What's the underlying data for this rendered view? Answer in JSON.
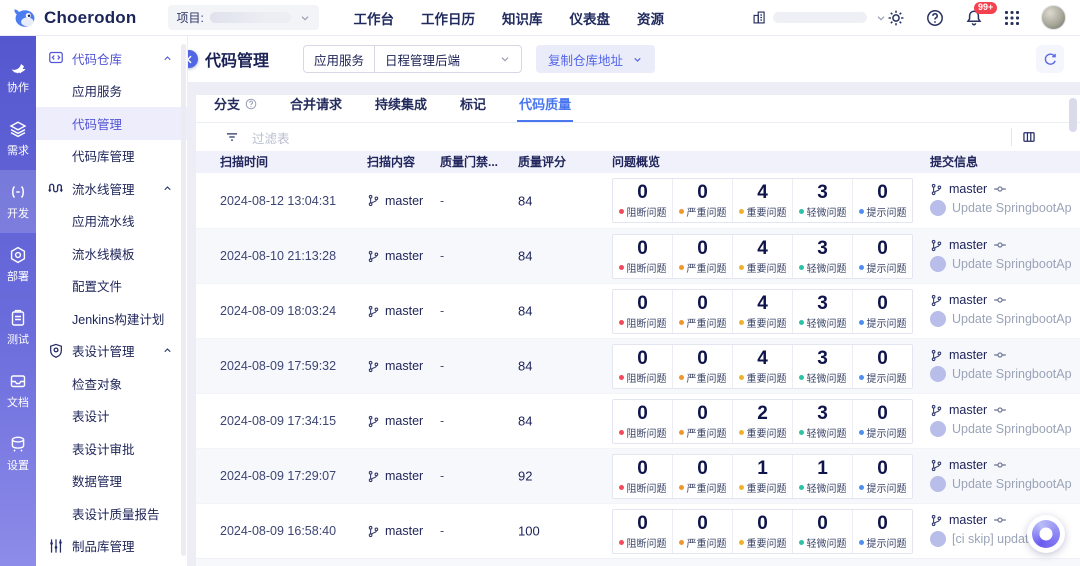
{
  "topbar": {
    "logo_text": "Choerodon",
    "project_label": "项目:",
    "nav": [
      {
        "label": "工作台"
      },
      {
        "label": "工作日历"
      },
      {
        "label": "知识库"
      },
      {
        "label": "仪表盘"
      },
      {
        "label": "资源"
      }
    ],
    "notification_badge": "99+"
  },
  "rail": {
    "items": [
      {
        "icon": "dove-icon",
        "label": "协作",
        "active": false
      },
      {
        "icon": "layers-icon",
        "label": "需求",
        "active": false
      },
      {
        "icon": "code-icon",
        "label": "开发",
        "active": true
      },
      {
        "icon": "hexagon-icon",
        "label": "部署",
        "active": false
      },
      {
        "icon": "clipboard-icon",
        "label": "测试",
        "active": false
      },
      {
        "icon": "inbox-icon",
        "label": "文档",
        "active": false
      },
      {
        "icon": "database-icon",
        "label": "设置",
        "active": false
      }
    ]
  },
  "sidebar": {
    "items": [
      {
        "type": "group",
        "icon": "code-repo-icon",
        "label": "代码仓库",
        "chevron": true,
        "accent": true
      },
      {
        "type": "item",
        "label": "应用服务"
      },
      {
        "type": "item",
        "label": "代码管理",
        "active": true
      },
      {
        "type": "item",
        "label": "代码库管理"
      },
      {
        "type": "group",
        "icon": "pipeline-icon",
        "label": "流水线管理",
        "chevron": true
      },
      {
        "type": "item",
        "label": "应用流水线"
      },
      {
        "type": "item",
        "label": "流水线模板"
      },
      {
        "type": "item",
        "label": "配置文件"
      },
      {
        "type": "item",
        "label": "Jenkins构建计划"
      },
      {
        "type": "group",
        "icon": "shield-icon",
        "label": "表设计管理",
        "chevron": true
      },
      {
        "type": "item",
        "label": "检查对象"
      },
      {
        "type": "item",
        "label": "表设计"
      },
      {
        "type": "item",
        "label": "表设计审批"
      },
      {
        "type": "item",
        "label": "数据管理"
      },
      {
        "type": "item",
        "label": "表设计质量报告"
      },
      {
        "type": "group",
        "icon": "sliders-icon",
        "label": "制品库管理",
        "chevron": false
      }
    ]
  },
  "page": {
    "title": "代码管理",
    "service_label": "应用服务",
    "service_value": "日程管理后端",
    "copy_repo_button": "复制仓库地址"
  },
  "tabs": [
    {
      "label": "分支",
      "help": true,
      "active": false
    },
    {
      "label": "合并请求",
      "active": false
    },
    {
      "label": "持续集成",
      "active": false
    },
    {
      "label": "标记",
      "active": false
    },
    {
      "label": "代码质量",
      "active": true
    }
  ],
  "filter": {
    "placeholder": "过滤表"
  },
  "table": {
    "columns": [
      {
        "label": "扫描时间",
        "cls": "col-time"
      },
      {
        "label": "扫描内容",
        "cls": "col-content"
      },
      {
        "label": "质量门禁...",
        "cls": "col-gate"
      },
      {
        "label": "质量评分",
        "cls": "col-score"
      },
      {
        "label": "问题概览",
        "cls": "col-issues"
      },
      {
        "label": "提交信息",
        "cls": "col-commit"
      }
    ],
    "issue_labels": [
      "阻断问题",
      "严重问题",
      "重要问题",
      "轻微问题",
      "提示问题"
    ],
    "issue_colors": [
      "#F5495C",
      "#F1962F",
      "#EFB32B",
      "#2BC2A7",
      "#4E8FF0"
    ],
    "rows": [
      {
        "time": "2024-08-12 13:04:31",
        "branch": "master",
        "gate": "-",
        "score": "84",
        "issues": [
          "0",
          "0",
          "4",
          "3",
          "0"
        ],
        "commit_branch": "master",
        "commit_message": "Update SpringbootAp"
      },
      {
        "time": "2024-08-10 21:13:28",
        "branch": "master",
        "gate": "-",
        "score": "84",
        "issues": [
          "0",
          "0",
          "4",
          "3",
          "0"
        ],
        "commit_branch": "master",
        "commit_message": "Update SpringbootAp"
      },
      {
        "time": "2024-08-09 18:03:24",
        "branch": "master",
        "gate": "-",
        "score": "84",
        "issues": [
          "0",
          "0",
          "4",
          "3",
          "0"
        ],
        "commit_branch": "master",
        "commit_message": "Update SpringbootAp"
      },
      {
        "time": "2024-08-09 17:59:32",
        "branch": "master",
        "gate": "-",
        "score": "84",
        "issues": [
          "0",
          "0",
          "4",
          "3",
          "0"
        ],
        "commit_branch": "master",
        "commit_message": "Update SpringbootAp"
      },
      {
        "time": "2024-08-09 17:34:15",
        "branch": "master",
        "gate": "-",
        "score": "84",
        "issues": [
          "0",
          "0",
          "2",
          "3",
          "0"
        ],
        "commit_branch": "master",
        "commit_message": "Update SpringbootAp"
      },
      {
        "time": "2024-08-09 17:29:07",
        "branch": "master",
        "gate": "-",
        "score": "92",
        "issues": [
          "0",
          "0",
          "1",
          "1",
          "0"
        ],
        "commit_branch": "master",
        "commit_message": "Update SpringbootAp"
      },
      {
        "time": "2024-08-09 16:58:40",
        "branch": "master",
        "gate": "-",
        "score": "100",
        "issues": [
          "0",
          "0",
          "0",
          "0",
          "0"
        ],
        "commit_branch": "master",
        "commit_message": "[ci skip] update ."
      }
    ]
  }
}
